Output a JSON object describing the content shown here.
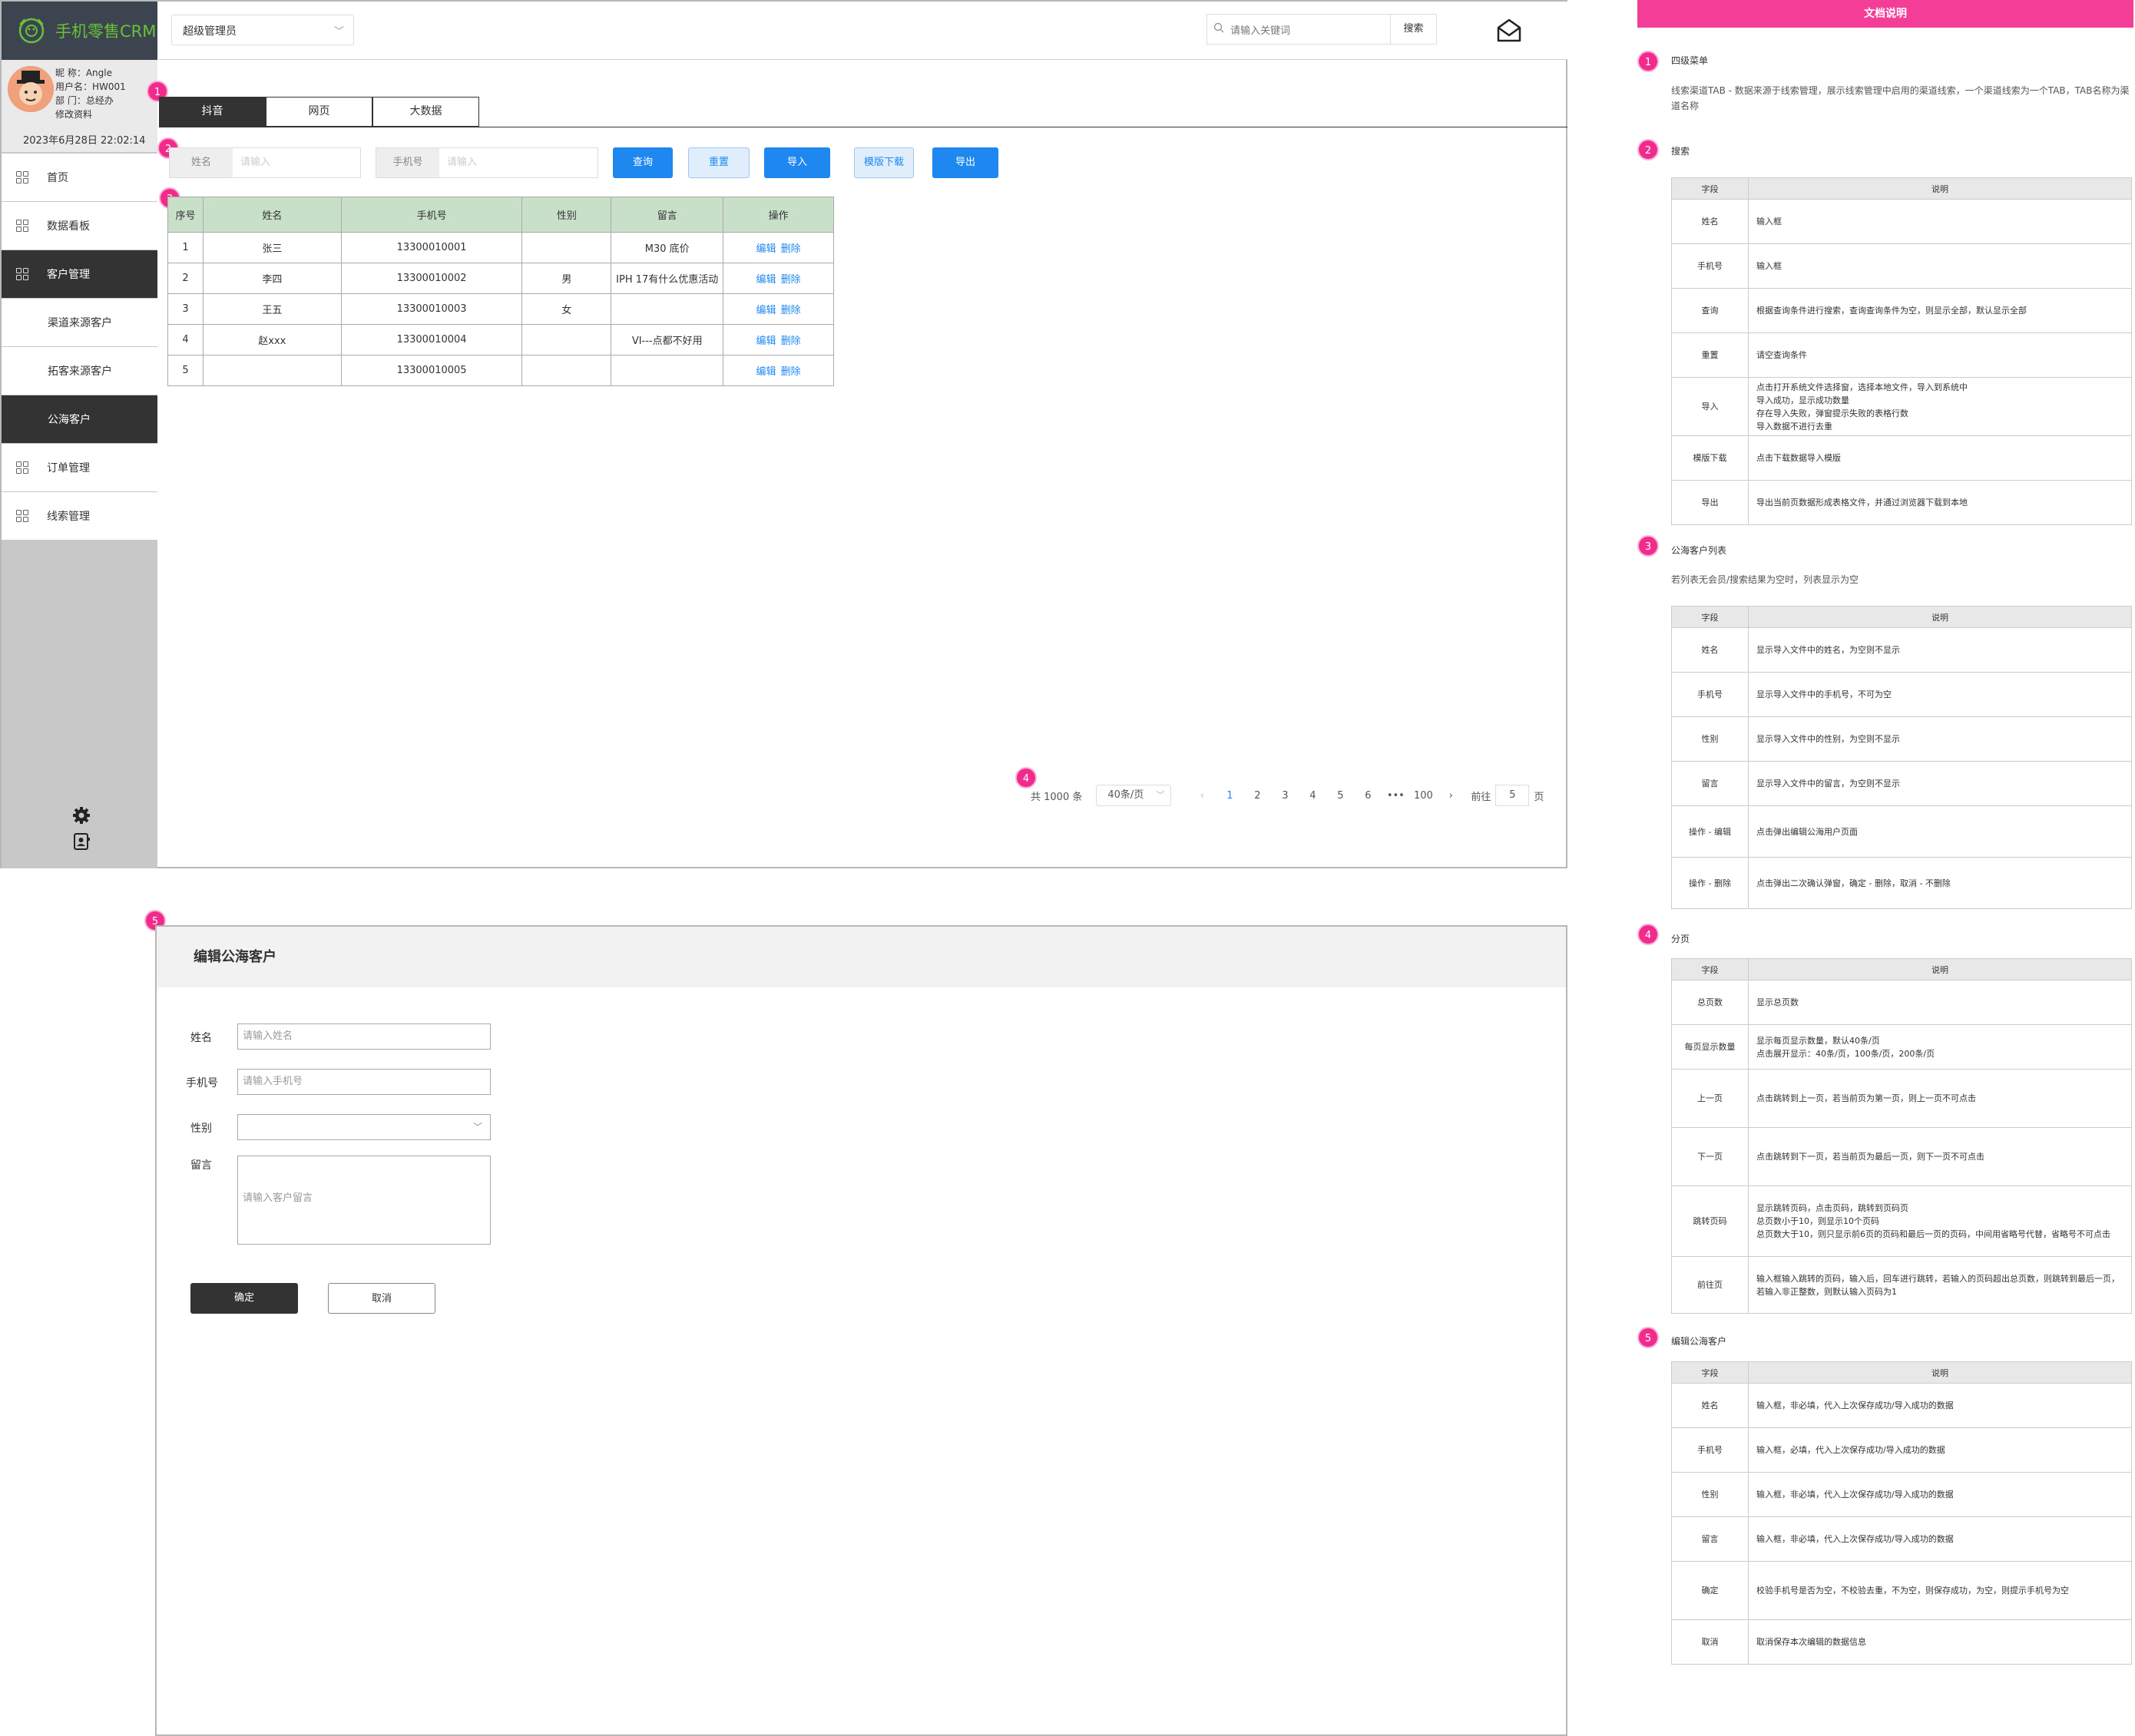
{
  "app": {
    "title": "手机零售CRM"
  },
  "user": {
    "nickname": "昵 称：Angle",
    "username": "用户名：HW001",
    "dept": "部 门：总经办",
    "edit": "修改资料",
    "datetime": "2023年6月28日  22:02:14"
  },
  "sidebar": {
    "items": [
      {
        "label": "首页",
        "type": "main"
      },
      {
        "label": "数据看板",
        "type": "main"
      },
      {
        "label": "客户管理",
        "type": "main-active"
      },
      {
        "label": "渠道来源客户",
        "type": "sub"
      },
      {
        "label": "拓客来源客户",
        "type": "sub"
      },
      {
        "label": "公海客户",
        "type": "sub-active"
      },
      {
        "label": "订单管理",
        "type": "main"
      },
      {
        "label": "线索管理",
        "type": "main"
      }
    ]
  },
  "topbar": {
    "role": "超级管理员",
    "search_placeholder": "请输入关键词",
    "search_btn": "搜索"
  },
  "tabs": [
    "抖音",
    "网页",
    "大数据"
  ],
  "filters": {
    "name_label": "姓名",
    "name_ph": "请输入",
    "phone_label": "手机号",
    "phone_ph": "请输入",
    "query": "查询",
    "reset": "重置",
    "import": "导入",
    "template": "模版下载",
    "export": "导出"
  },
  "table": {
    "headers": [
      "序号",
      "姓名",
      "手机号",
      "性别",
      "留言",
      "操作"
    ],
    "rows": [
      [
        "1",
        "张三",
        "13300010001",
        "",
        "M30 底价"
      ],
      [
        "2",
        "李四",
        "13300010002",
        "男",
        "IPH 17有什么优惠活动"
      ],
      [
        "3",
        "王五",
        "13300010003",
        "女",
        ""
      ],
      [
        "4",
        "赵xxx",
        "13300010004",
        "",
        "VI---点都不好用"
      ],
      [
        "5",
        "",
        "13300010005",
        "",
        ""
      ]
    ],
    "edit": "编辑",
    "delete": "删除"
  },
  "pager": {
    "total": "共 1000 条",
    "size": "40条/页",
    "pages": [
      "1",
      "2",
      "3",
      "4",
      "5",
      "6",
      "•••",
      "100"
    ],
    "goto": "前往",
    "goto_val": "5",
    "page_unit": "页",
    "prev": "‹",
    "next": "›"
  },
  "badges": [
    "1",
    "2",
    "3",
    "4",
    "5"
  ],
  "edit": {
    "title": "编辑公海客户",
    "name_label": "姓名",
    "name_ph": "请输入姓名",
    "phone_label": "手机号",
    "phone_ph": "请输入手机号",
    "gender_label": "性别",
    "msg_label": "留言",
    "msg_ph": "请输入客户留言",
    "ok": "确定",
    "cancel": "取消"
  },
  "doc": {
    "title": "文档说明",
    "s1": {
      "title": "四级菜单",
      "desc": "线索渠道TAB - 数据来源于线索管理，展示线索管理中启用的渠道线索，一个渠道线索为一个TAB，TAB名称为渠道名称"
    },
    "col_field": "字段",
    "col_desc": "说明",
    "s2": {
      "title": "搜索",
      "rows": [
        [
          "姓名",
          "输入框"
        ],
        [
          "手机号",
          "输入框"
        ],
        [
          "查询",
          "根据查询条件进行搜索，查询查询条件为空，则显示全部，默认显示全部"
        ],
        [
          "重置",
          "请空查询条件"
        ],
        [
          "导入",
          "点击打开系统文件选择窗，选择本地文件，导入到系统中\n导入成功，显示成功数量\n存在导入失败，弹窗提示失败的表格行数\n导入数据不进行去重"
        ],
        [
          "模版下载",
          "点击下载数据导入模版"
        ],
        [
          "导出",
          "导出当前页数据形成表格文件，并通过浏览器下载到本地"
        ]
      ]
    },
    "s3": {
      "title": "公海客户列表",
      "desc": "若列表无会员/搜索结果为空时，列表显示为空",
      "rows": [
        [
          "姓名",
          "显示导入文件中的姓名，为空则不显示"
        ],
        [
          "手机号",
          "显示导入文件中的手机号，不可为空"
        ],
        [
          "性别",
          "显示导入文件中的性别，为空则不显示"
        ],
        [
          "留言",
          "显示导入文件中的留言，为空则不显示"
        ],
        [
          "操作 - 编辑",
          "点击弹出编辑公海用户页面"
        ],
        [
          "操作 - 删除",
          "点击弹出二次确认弹窗，确定 - 删除，取消 - 不删除"
        ]
      ]
    },
    "s4": {
      "title": "分页",
      "rows": [
        [
          "总页数",
          "显示总页数"
        ],
        [
          "每页显示数量",
          "显示每页显示数量，默认40条/页\n点击展开显示：40条/页，100条/页，200条/页"
        ],
        [
          "上一页",
          "点击跳转到上一页，若当前页为第一页，则上一页不可点击"
        ],
        [
          "下一页",
          "点击跳转到下一页，若当前页为最后一页，则下一页不可点击"
        ],
        [
          "跳转页码",
          "显示跳转页码，点击页码，跳转到页码页\n总页数小于10，则显示10个页码\n总页数大于10，则只显示前6页的页码和最后一页的页码，中间用省略号代替，省略号不可点击"
        ],
        [
          "前往页",
          "输入框输入跳转的页码，输入后，回车进行跳转，若输入的页码超出总页数，则跳转到最后一页，若输入非正整数，则默认输入页码为1"
        ]
      ]
    },
    "s5": {
      "title": "编辑公海客户",
      "rows": [
        [
          "姓名",
          "输入框，非必填，代入上次保存成功/导入成功的数据"
        ],
        [
          "手机号",
          "输入框，必填，代入上次保存成功/导入成功的数据"
        ],
        [
          "性别",
          "输入框，非必填，代入上次保存成功/导入成功的数据"
        ],
        [
          "留言",
          "输入框，非必填，代入上次保存成功/导入成功的数据"
        ],
        [
          "确定",
          "校验手机号是否为空，不校验去重，不为空，则保存成功，为空，则提示手机号为空"
        ],
        [
          "取消",
          "取消保存本次编辑的数据信息"
        ]
      ]
    }
  }
}
